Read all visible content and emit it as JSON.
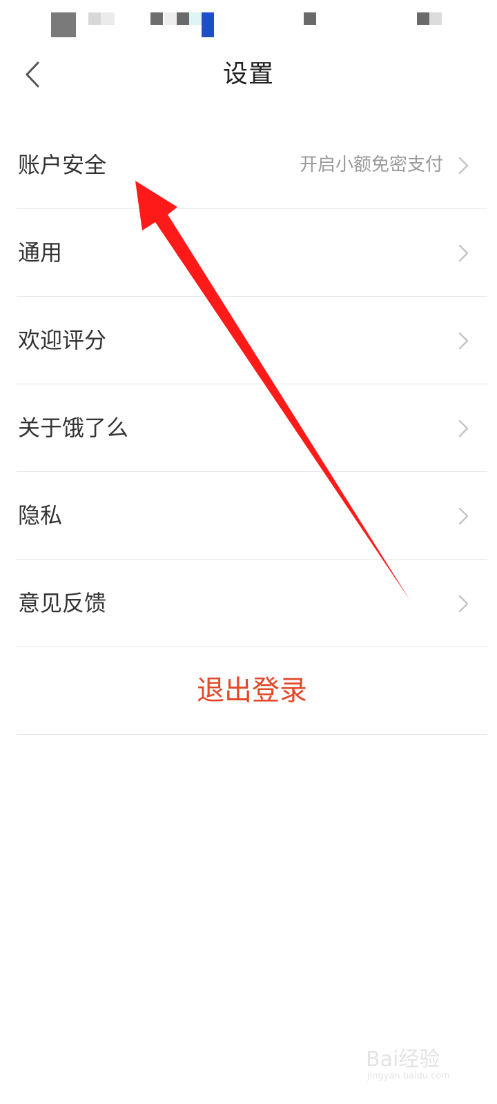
{
  "header": {
    "title": "设置",
    "back_icon": "chevron-left-icon"
  },
  "settings": {
    "items": [
      {
        "label": "账户安全",
        "subtext": "开启小额免密支付"
      },
      {
        "label": "通用",
        "subtext": ""
      },
      {
        "label": "欢迎评分",
        "subtext": ""
      },
      {
        "label": "关于饿了么",
        "subtext": ""
      },
      {
        "label": "隐私",
        "subtext": ""
      },
      {
        "label": "意见反馈",
        "subtext": ""
      }
    ],
    "logout_label": "退出登录"
  },
  "colors": {
    "logout": "#e2492a",
    "annotation_arrow": "#ff1a1a",
    "divider": "#e6e6e6"
  },
  "watermark": {
    "brand": "Bai经验",
    "site": "jingyan.baidu.com"
  }
}
